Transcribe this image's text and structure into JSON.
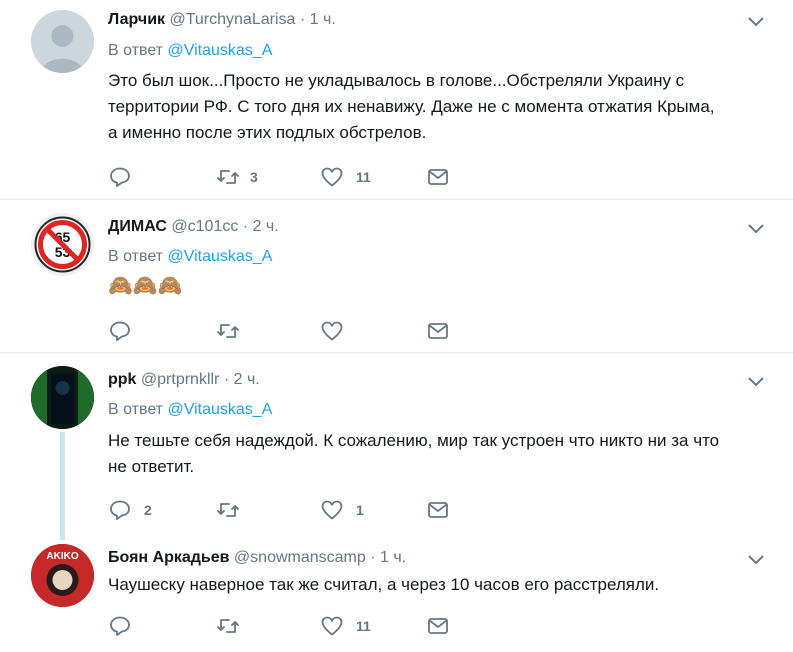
{
  "tweets": [
    {
      "name": "Ларчик",
      "handle": "@TurchynaLarisa",
      "dot": "·",
      "time": "1 ч.",
      "reply_prefix": "В ответ",
      "reply_to": "@Vitauskas_A",
      "text_lines": [
        "Это был шок...Просто не укладывалось в голове...Обстреляли Украину с",
        "территории РФ. С того дня их ненавижу. Даже не с момента отжатия Крыма,",
        "а именно после этих подлых обстрелов."
      ],
      "retweets": "3",
      "likes": "11"
    },
    {
      "name": "ДИМАС",
      "handle": "@c101cc",
      "dot": "·",
      "time": "2 ч.",
      "reply_prefix": "В ответ",
      "reply_to": "@Vitauskas_A",
      "emoji": "🙈🙈🙈",
      "avatar_text_top": "65",
      "avatar_text_bottom": "53",
      "retweets": "",
      "likes": ""
    },
    {
      "name": "ppk",
      "handle": "@prtprnkllr",
      "dot": "·",
      "time": "2 ч.",
      "reply_prefix": "В ответ",
      "reply_to": "@Vitauskas_A",
      "text_lines": [
        "Не тешьте себя надеждой. К сожалению, мир так устроен что никто ни за что",
        "не ответит."
      ],
      "replies": "2",
      "likes": "1"
    },
    {
      "name": "Боян Аркадьев",
      "handle": "@snowmanscamp",
      "dot": "·",
      "time": "1 ч.",
      "avatar_text": "AKIKO",
      "text_lines": [
        "Чаушеску наверное так же считал, а через 10 часов его расстреляли."
      ],
      "likes": "11"
    }
  ],
  "colors": {
    "link": "#1da1f2",
    "muted": "#657786",
    "border": "#e6ecf0",
    "thread": "#c4e4f8"
  }
}
